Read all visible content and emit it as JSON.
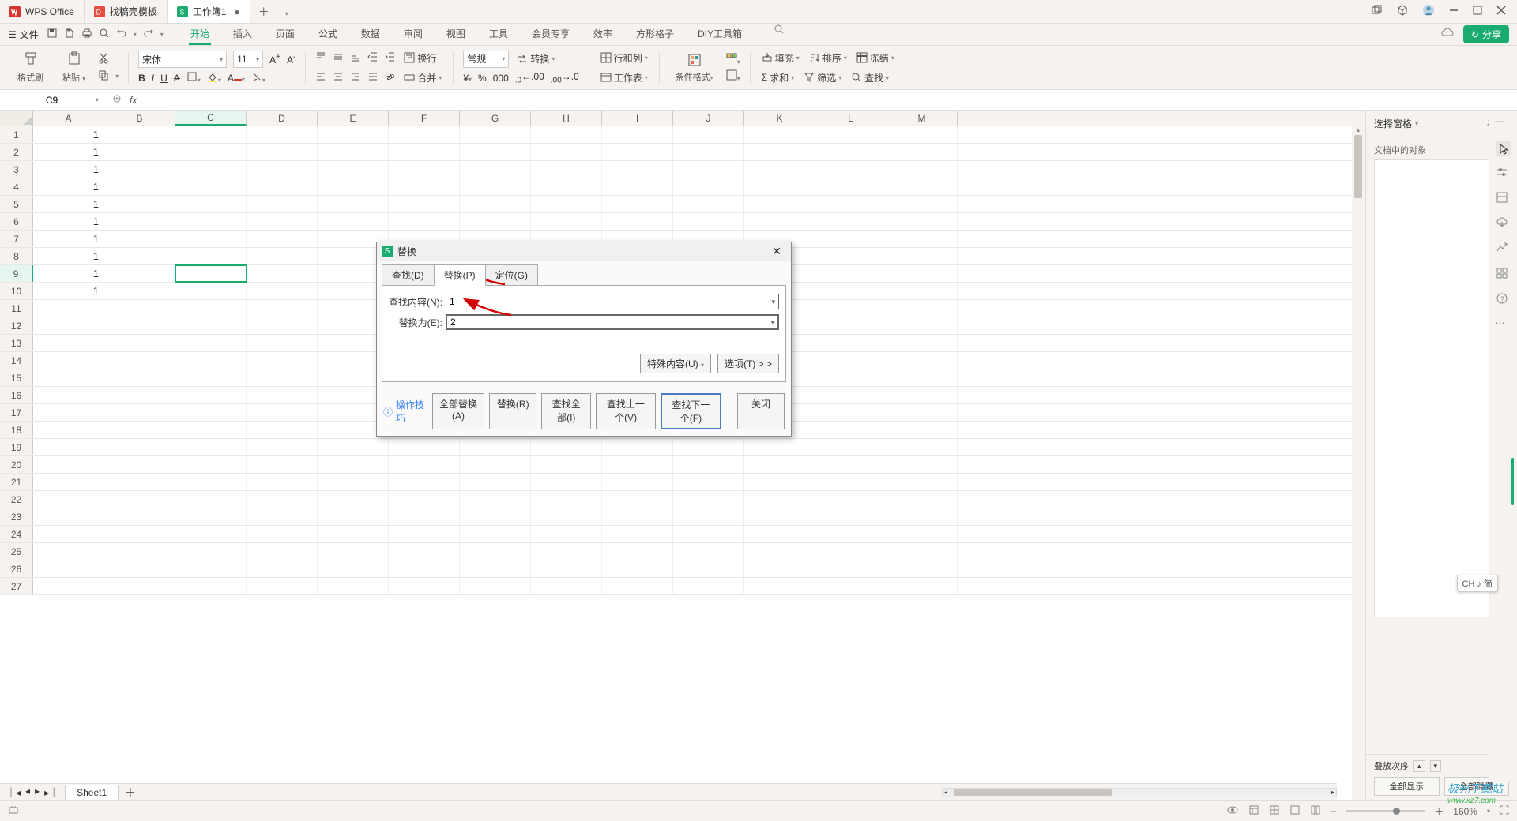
{
  "titlebar": {
    "tabs": [
      {
        "icon": "wps",
        "label": "WPS Office"
      },
      {
        "icon": "docer",
        "label": "找稿壳模板"
      },
      {
        "icon": "sheet",
        "label": "工作簿1",
        "modified": true,
        "active": true
      }
    ]
  },
  "menubar": {
    "file_label": "文件",
    "items": [
      "开始",
      "插入",
      "页面",
      "公式",
      "数据",
      "审阅",
      "视图",
      "工具",
      "会员专享",
      "效率",
      "方形格子",
      "DIY工具箱"
    ],
    "active_index": 0,
    "share_label": "分享"
  },
  "ribbon": {
    "format_brush": "格式刷",
    "paste": "粘贴",
    "font_name": "宋体",
    "font_size": "11",
    "wrap_text": "换行",
    "merge": "合并",
    "number_format": "常规",
    "convert": "转换",
    "rowcol": "行和列",
    "worksheet": "工作表",
    "cond_fmt": "条件格式",
    "fill": "填充",
    "sort": "排序",
    "freeze": "冻结",
    "sum": "求和",
    "filter": "筛选",
    "find": "查找"
  },
  "formula_bar": {
    "cell_ref": "C9",
    "formula": ""
  },
  "sheet": {
    "columns": [
      "A",
      "B",
      "C",
      "D",
      "E",
      "F",
      "G",
      "H",
      "I",
      "J",
      "K",
      "L",
      "M"
    ],
    "row_count": 27,
    "selected_col": "C",
    "selected_row": 9,
    "data_col_a": [
      "1",
      "1",
      "1",
      "1",
      "1",
      "1",
      "1",
      "1",
      "1",
      "1"
    ]
  },
  "right_pane": {
    "title": "选择窗格",
    "subtitle": "文档中的对象",
    "stack_label": "叠放次序",
    "btn_show_all": "全部显示",
    "btn_hide_all": "全部隐藏"
  },
  "sheet_tabs": {
    "sheet_name": "Sheet1"
  },
  "statusbar": {
    "zoom": "160%"
  },
  "dialog": {
    "title": "替换",
    "tabs": [
      "查找(D)",
      "替换(P)",
      "定位(G)"
    ],
    "active_tab": 1,
    "find_label": "查找内容(N):",
    "find_value": "1",
    "replace_label": "替换为(E):",
    "replace_value": "2",
    "special_btn": "特殊内容(U)",
    "options_btn": "选项(T) > >",
    "tip_label": "操作技巧",
    "buttons": {
      "replace_all": "全部替换(A)",
      "replace": "替换(R)",
      "find_all": "查找全部(I)",
      "find_prev": "查找上一个(V)",
      "find_next": "查找下一个(F)",
      "close": "关闭"
    }
  },
  "ime": "CH ♪ 简",
  "watermark": {
    "name": "极光下载站",
    "url": "www.xz7.com"
  }
}
